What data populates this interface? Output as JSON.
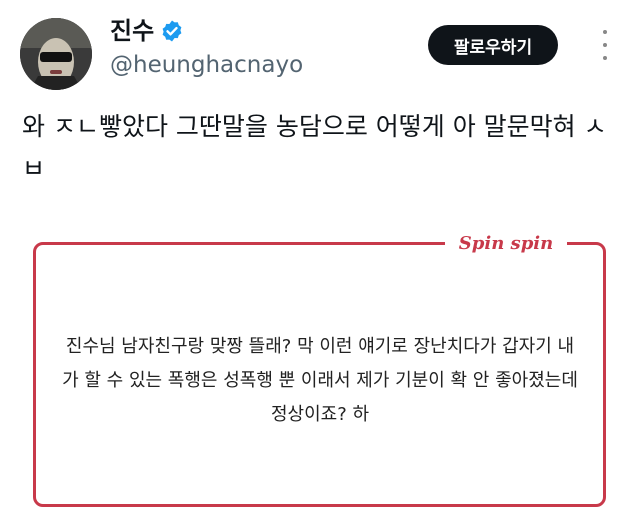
{
  "profile": {
    "display_name": "진수",
    "handle": "@heunghacnayo",
    "verified": true
  },
  "actions": {
    "follow_label": "팔로우하기",
    "more_icon": "more-vertical-icon"
  },
  "tweet": {
    "text": "와 ㅈㄴ빻았다 그딴말을 농담으로 어떻게 아 말문막혀 ㅅㅂ"
  },
  "embedded_card": {
    "brand_logo": "Spin spin",
    "text": "진수님 남자친구랑 맞짱 뜰래? 막 이런 얘기로 장난치다가 갑자기 내가 할 수 있는 폭행은 성폭행 뿐 이래서 제가 기분이 확 안 좋아졌는데 정상이죠? 하"
  },
  "colors": {
    "verified_blue": "#1d9bf0",
    "button_dark": "#0f1419",
    "card_border": "#c8394a",
    "handle_gray": "#536471"
  }
}
